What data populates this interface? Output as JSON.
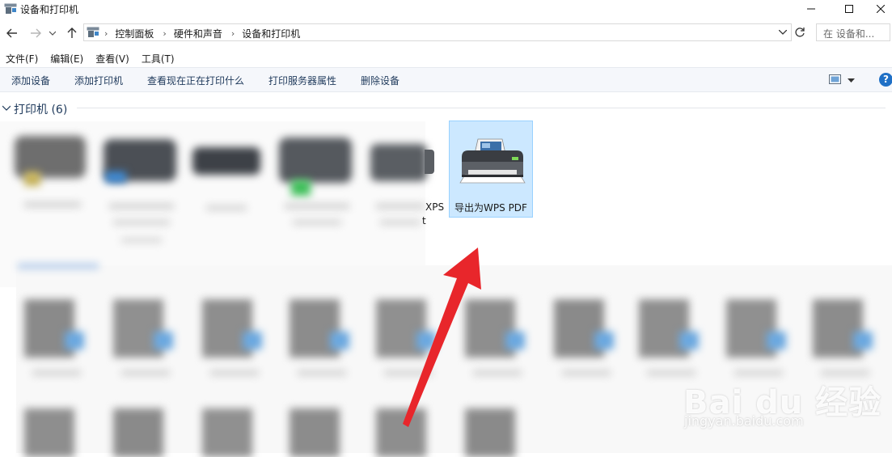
{
  "window": {
    "title": "设备和打印机"
  },
  "nav": {
    "breadcrumbs": [
      "控制面板",
      "硬件和声音",
      "设备和打印机"
    ],
    "search_placeholder": "在 设备和..."
  },
  "menu": [
    "文件(F)",
    "编辑(E)",
    "查看(V)",
    "工具(T)"
  ],
  "commands": [
    "添加设备",
    "添加打印机",
    "查看现在正在打印什么",
    "打印服务器属性",
    "删除设备"
  ],
  "help_label": "?",
  "group": {
    "title": "打印机 (6)"
  },
  "selected_device": {
    "label": "导出为WPS PDF"
  },
  "partial_labels": [
    "XPS",
    "t"
  ],
  "watermark": {
    "brand": "Bai du 经验",
    "url": "jingyan.baidu.com"
  },
  "colors": {
    "selection_bg": "#cce8ff",
    "selection_border": "#99d1ff",
    "arrow": "#e8262b",
    "help": "#1f70c6"
  }
}
